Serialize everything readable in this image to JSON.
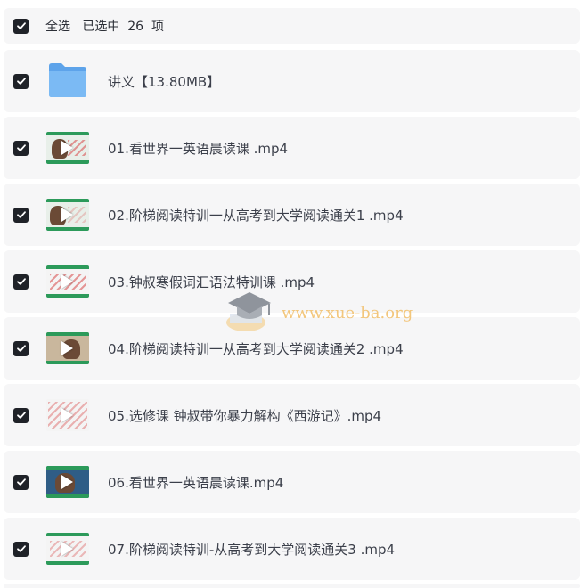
{
  "header": {
    "select_all_label": "全选",
    "selected_text": "已选中  26  项"
  },
  "items": [
    {
      "name": "讲义【13.80MB】",
      "type": "folder",
      "checked": true
    },
    {
      "name": "01.看世界一英语晨读课 .mp4",
      "type": "video",
      "checked": true
    },
    {
      "name": "02.阶梯阅读特训一从高考到大学阅读通关1 .mp4",
      "type": "video",
      "checked": true
    },
    {
      "name": "03.钟叔寒假词汇语法特训课 .mp4",
      "type": "video",
      "checked": true
    },
    {
      "name": "04.阶梯阅读特训一从高考到大学阅读通关2 .mp4",
      "type": "video",
      "checked": true
    },
    {
      "name": "05.选修课 钟叔带你暴力解构《西游记》.mp4",
      "type": "video",
      "checked": true
    },
    {
      "name": "06.看世界一英语晨读课.mp4",
      "type": "video",
      "checked": true
    },
    {
      "name": "07.阶梯阅读特训-从高考到大学阅读通关3 .mp4",
      "type": "video",
      "checked": true
    }
  ],
  "watermark": {
    "text": "www.xue-ba.org"
  },
  "colors": {
    "row_bg": "#f6f6f7",
    "checkbox": "#1f2228",
    "folder": "#6aaef0",
    "thumb_accent": "#2c9a5a"
  }
}
